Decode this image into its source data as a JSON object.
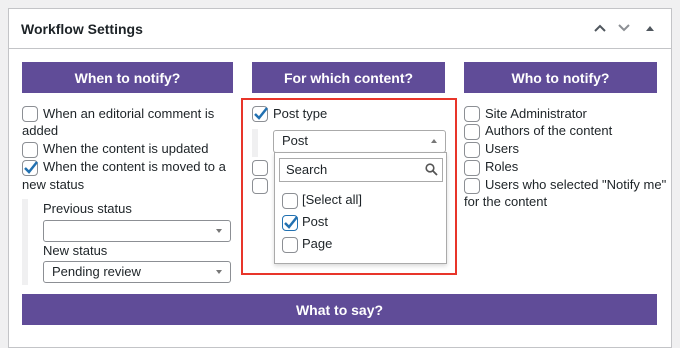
{
  "panel": {
    "title": "Workflow Settings",
    "icons": [
      "chevron-up-icon",
      "chevron-down-icon",
      "triangle-up-icon"
    ]
  },
  "columns": {
    "when": {
      "heading": "When to notify?",
      "options": [
        {
          "label_line1": "When an editorial comment is",
          "label_line2": "added",
          "checked": false
        },
        {
          "label": "When the content is updated",
          "checked": false
        },
        {
          "label_line1": "When the content is moved to a",
          "label_line2": "new status",
          "checked": true
        }
      ],
      "previous_status_label": "Previous status",
      "previous_status_value": "",
      "new_status_label": "New status",
      "new_status_value": "Pending review"
    },
    "content": {
      "heading": "For which content?",
      "post_type_label": "Post type",
      "post_type_checked": true,
      "post_type_value": "Post",
      "dropdown": {
        "search_placeholder": "Search",
        "options": [
          {
            "label": "[Select all]",
            "checked": false
          },
          {
            "label": "Post",
            "checked": true
          },
          {
            "label": "Page",
            "checked": false
          }
        ]
      }
    },
    "who": {
      "heading": "Who to notify?",
      "options": [
        {
          "label": "Site Administrator",
          "checked": false
        },
        {
          "label": "Authors of the content",
          "checked": false
        },
        {
          "label": "Users",
          "checked": false
        },
        {
          "label": "Roles",
          "checked": false
        },
        {
          "label_line1": "Users who selected \"Notify me\"",
          "label_line2": "for the content",
          "checked": false
        }
      ]
    }
  },
  "bottom": {
    "heading": "What to say?"
  },
  "colors": {
    "accent": "#604c98",
    "highlight": "#e8352a",
    "check": "#2271b1"
  }
}
